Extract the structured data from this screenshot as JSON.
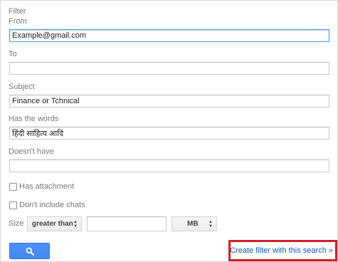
{
  "filter": {
    "title": "Filter",
    "from": {
      "label": "From",
      "value": "Example@gmail.com"
    },
    "to": {
      "label": "To",
      "value": ""
    },
    "subject": {
      "label": "Subject",
      "value": "Finance or Tchnical"
    },
    "has_words": {
      "label": "Has the words",
      "value": "हिंदी साहित्य आदि"
    },
    "doesnt_have": {
      "label": "Doesn't have",
      "value": ""
    },
    "has_attachment": {
      "label": "Has attachment",
      "checked": false
    },
    "dont_include_chats": {
      "label": "Don't include chats",
      "checked": false
    },
    "size": {
      "label": "Size",
      "comparator": "greater than",
      "value": "",
      "unit": "MB"
    },
    "search_button": {
      "icon": "search-icon",
      "color": "#4d90fe"
    },
    "create_link": {
      "label": "Create filter with this search »",
      "highlight_color": "#d21f26"
    }
  }
}
